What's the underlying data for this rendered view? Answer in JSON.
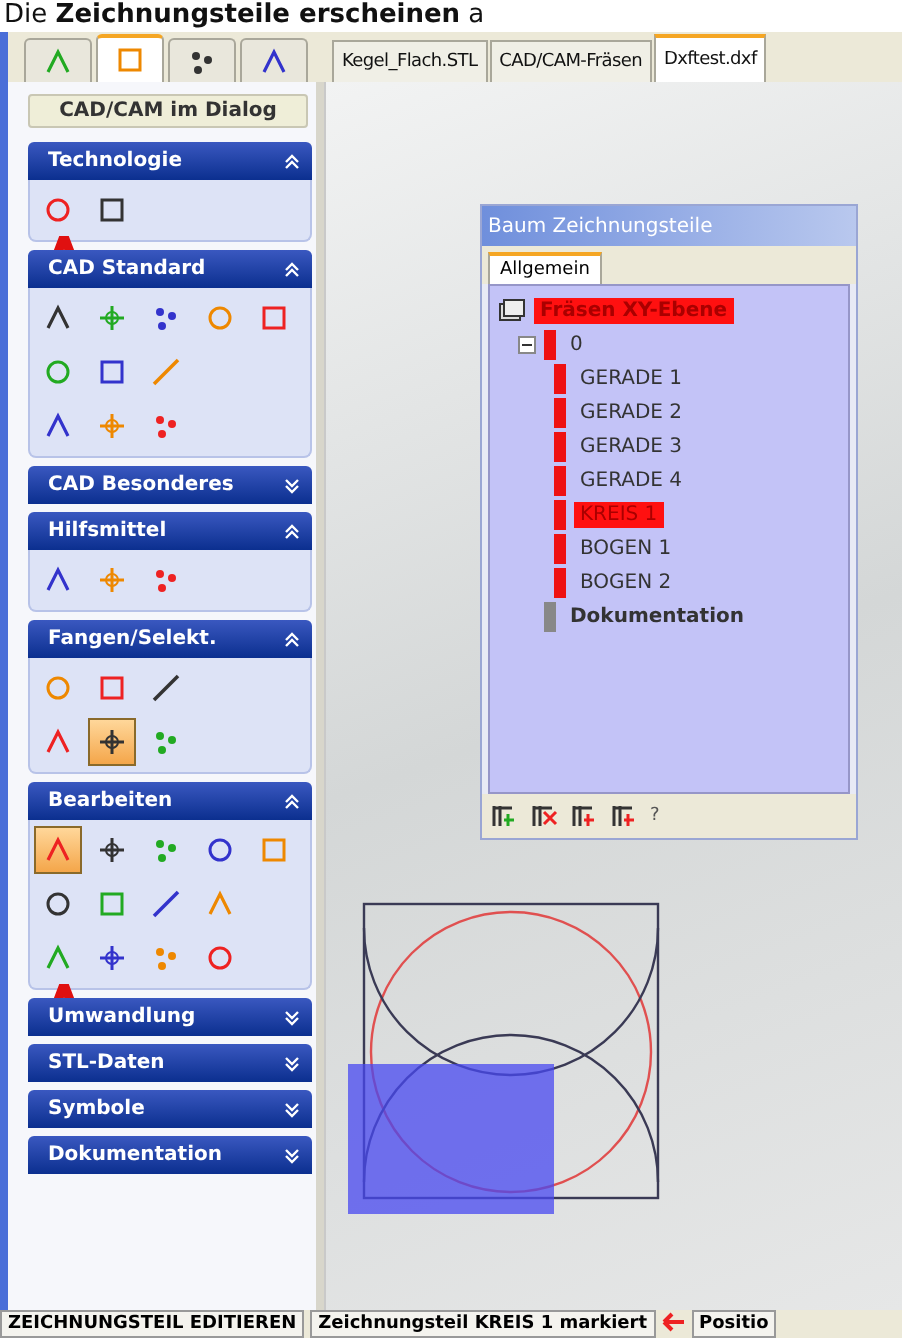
{
  "caption": "Die **Zeichnungsteile erscheinen** a",
  "mode_tabs": [
    {
      "selected": false
    },
    {
      "selected": true
    },
    {
      "selected": false
    },
    {
      "selected": false
    }
  ],
  "document_tabs": [
    {
      "label": "Kegel_Flach.STL",
      "selected": false
    },
    {
      "label": "CAD/CAM-Fräsen",
      "selected": false
    },
    {
      "label": "Dxftest.dxf",
      "selected": true
    }
  ],
  "sidebar": {
    "dialog_button": "CAD/CAM im Dialog",
    "sections": [
      {
        "title": "Technologie",
        "expanded": true,
        "rows": [
          [
            {
              "selected": false
            },
            {
              "selected": false
            }
          ]
        ]
      },
      {
        "title": "CAD Standard",
        "expanded": true,
        "rows": [
          [
            {
              "selected": false
            },
            {
              "selected": false
            },
            {
              "selected": false
            },
            {
              "selected": false
            },
            {
              "selected": false
            }
          ],
          [
            {
              "selected": false
            },
            {
              "selected": false
            },
            {
              "selected": false
            }
          ],
          [
            {
              "selected": false
            },
            {
              "selected": false
            },
            {
              "selected": false
            }
          ]
        ]
      },
      {
        "title": "CAD Besonderes",
        "expanded": false
      },
      {
        "title": "Hilfsmittel",
        "expanded": true,
        "rows": [
          [
            {
              "selected": false
            },
            {
              "selected": false
            },
            {
              "selected": false
            }
          ]
        ]
      },
      {
        "title": "Fangen/Selekt.",
        "expanded": true,
        "rows": [
          [
            {
              "selected": false
            },
            {
              "selected": false
            },
            {
              "selected": false
            }
          ],
          [
            {
              "selected": false
            },
            {
              "selected": true
            },
            {
              "selected": false
            }
          ]
        ]
      },
      {
        "title": "Bearbeiten",
        "expanded": true,
        "rows": [
          [
            {
              "selected": true
            },
            {
              "selected": false
            },
            {
              "selected": false
            },
            {
              "selected": false
            },
            {
              "selected": false
            }
          ],
          [
            {
              "selected": false
            },
            {
              "selected": false
            },
            {
              "selected": false
            },
            {
              "selected": false
            }
          ],
          [
            {
              "selected": false
            },
            {
              "selected": false
            },
            {
              "selected": false
            },
            {
              "selected": false
            }
          ]
        ]
      },
      {
        "title": "Umwandlung",
        "expanded": false
      },
      {
        "title": "STL-Daten",
        "expanded": false
      },
      {
        "title": "Symbole",
        "expanded": false
      },
      {
        "title": "Dokumentation",
        "expanded": false
      }
    ]
  },
  "tree_window": {
    "title": "Baum Zeichnungsteile",
    "tabs": [
      {
        "label": "Allgemein",
        "selected": true
      }
    ],
    "tree": [
      {
        "label": "Fräsen XY-Ebene",
        "highlighted": true,
        "children": [
          {
            "label": "0",
            "color": "#ee1111",
            "highlighted": false,
            "expanded": true,
            "children": [
              {
                "label": "GERADE 1",
                "color": "#ee1111",
                "highlighted": false
              },
              {
                "label": "GERADE 2",
                "color": "#ee1111",
                "highlighted": false
              },
              {
                "label": "GERADE 3",
                "color": "#ee1111",
                "highlighted": false
              },
              {
                "label": "GERADE 4",
                "color": "#ee1111",
                "highlighted": false
              },
              {
                "label": "KREIS 1",
                "color": "#ee1111",
                "highlighted": true
              },
              {
                "label": "BOGEN 1",
                "color": "#ee1111",
                "highlighted": false
              },
              {
                "label": "BOGEN 2",
                "color": "#ee1111",
                "highlighted": false
              }
            ]
          },
          {
            "label": "Dokumentation",
            "color": "#888888",
            "highlighted": false,
            "bold": true
          }
        ]
      }
    ],
    "help": "?"
  },
  "status_bar": {
    "mode": "ZEICHNUNGSTEIL EDITIEREN",
    "message": "Zeichnungsteil KREIS 1  markiert",
    "position": "Positio"
  }
}
